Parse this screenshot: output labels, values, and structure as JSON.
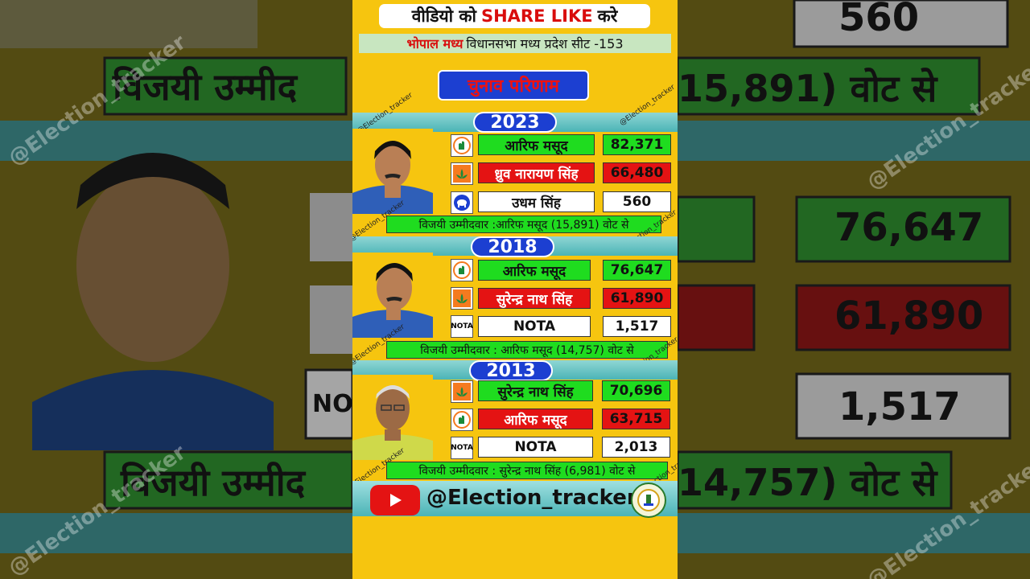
{
  "header": {
    "prefix": "वीडियो को",
    "highlight": "SHARE LIKE",
    "suffix": "करे"
  },
  "seat": {
    "city": "भोपाल मध्य",
    "rest": "विधानसभा मध्य प्रदेश सीट -153"
  },
  "result_title": "चुनाव परिणाम",
  "watermark": "@Election_tracker",
  "elections": [
    {
      "year": "2023",
      "candidates": [
        {
          "party_icon": "congress-hand-icon",
          "name": "आरिफ मसूद",
          "votes": "82,371",
          "status": "winner"
        },
        {
          "party_icon": "bjp-lotus-icon",
          "name": "ध्रुव नारायण सिंह",
          "votes": "66,480",
          "status": "runner"
        },
        {
          "party_icon": "bsp-elephant-icon",
          "name": "उधम सिंह",
          "votes": "560",
          "status": "other"
        }
      ],
      "winner_text": "विजयी उम्मीदवार :आरिफ मसूद (15,891) वोट से"
    },
    {
      "year": "2018",
      "candidates": [
        {
          "party_icon": "congress-hand-icon",
          "name": "आरिफ मसूद",
          "votes": "76,647",
          "status": "winner"
        },
        {
          "party_icon": "bjp-lotus-icon",
          "name": "सुरेन्द्र नाथ सिंह",
          "votes": "61,890",
          "status": "runner"
        },
        {
          "party_icon": "nota-icon",
          "name": "NOTA",
          "votes": "1,517",
          "status": "other",
          "icon_text": "NOTA"
        }
      ],
      "winner_text": "विजयी उम्मीदवार : आरिफ मसूद (14,757) वोट से"
    },
    {
      "year": "2013",
      "candidates": [
        {
          "party_icon": "bjp-lotus-icon",
          "name": "सुरेन्द्र नाथ सिंह",
          "votes": "70,696",
          "status": "winner"
        },
        {
          "party_icon": "congress-hand-icon",
          "name": "आरिफ मसूद",
          "votes": "63,715",
          "status": "runner"
        },
        {
          "party_icon": "nota-icon",
          "name": "NOTA",
          "votes": "2,013",
          "status": "other",
          "icon_text": "NOTA"
        }
      ],
      "winner_text": "विजयी उम्मीदवार : सुरेन्द्र नाथ सिंह (6,981) वोट से"
    }
  ],
  "footer": {
    "handle": "@Election_tracker"
  },
  "background": {
    "left_banner": "विजयी उम्मीद",
    "right_banner_top": "15,891) वोट से",
    "right_votes": [
      "560",
      "76,647",
      "61,890",
      "1,517"
    ],
    "right_bottom": "14,757) वोट से",
    "left_nota": "NOT"
  },
  "colors": {
    "yellow": "#f6c50f",
    "green": "#1fdc1f",
    "red": "#e41313",
    "blue": "#1c3fd1",
    "teal": "#4bb4b6"
  }
}
